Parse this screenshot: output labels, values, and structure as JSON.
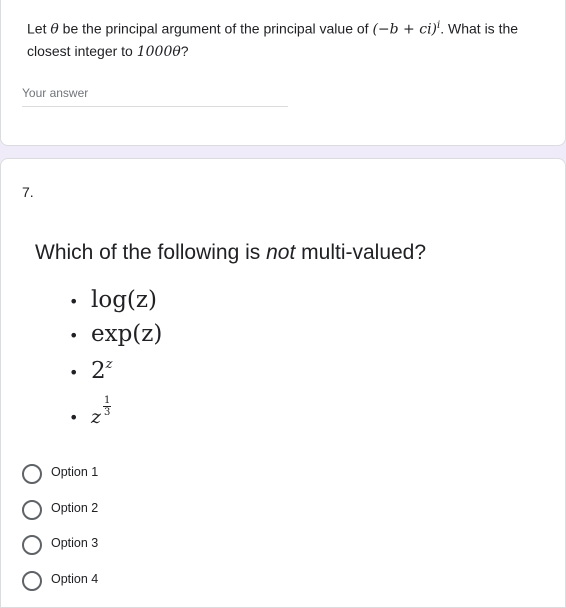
{
  "question6": {
    "text_before": "Let ",
    "theta_symbol": "θ",
    "text_mid": " be the principal argument of the principal value of ",
    "expression": "(−b + ci)",
    "expression_exponent": "i",
    "text_after": ". What is the closest integer to ",
    "target_value": "1000θ",
    "text_end": "?",
    "answer_placeholder": "Your answer"
  },
  "question7": {
    "number": "7.",
    "title_before": "Which of the following is ",
    "title_emphasis": "not",
    "title_after": " multi-valued?",
    "bullet": "•",
    "items": [
      {
        "base": "log(z)"
      },
      {
        "base": "exp(z)"
      },
      {
        "base": "2",
        "exponent": "z"
      },
      {
        "base": "z",
        "frac_num": "1",
        "frac_den": "3"
      }
    ],
    "options": [
      {
        "label": "Option 1",
        "selected": false
      },
      {
        "label": "Option 2",
        "selected": false
      },
      {
        "label": "Option 3",
        "selected": false
      },
      {
        "label": "Option 4",
        "selected": false
      }
    ]
  },
  "colors": {
    "page_background": "#f0ebf8",
    "card_background": "#ffffff",
    "card_border": "#dadce0",
    "text": "#202124",
    "muted_text": "#70757a",
    "radio_border": "#5f6368"
  }
}
